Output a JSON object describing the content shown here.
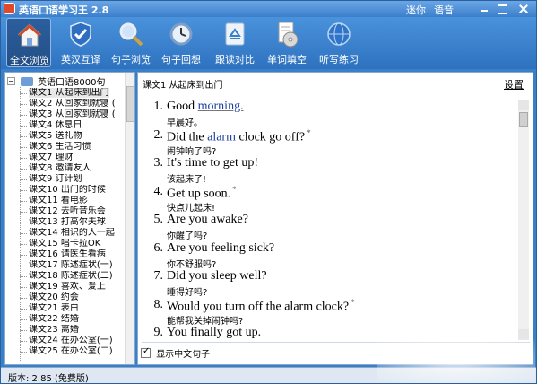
{
  "window": {
    "title": "英语口语学习王 2.8",
    "title_buttons": [
      "迷你",
      "语音"
    ]
  },
  "toolbar": {
    "items": [
      {
        "label": "全文浏览",
        "icon": "home-icon",
        "active": true
      },
      {
        "label": "英汉互译",
        "icon": "shield-check-icon",
        "active": false
      },
      {
        "label": "句子浏览",
        "icon": "magnifier-icon",
        "active": false
      },
      {
        "label": "句子回想",
        "icon": "clock-icon",
        "active": false
      },
      {
        "label": "跟读对比",
        "icon": "recycle-icon",
        "active": false
      },
      {
        "label": "单词填空",
        "icon": "document-disc-icon",
        "active": false
      },
      {
        "label": "听写练习",
        "icon": "globe-icon",
        "active": false
      }
    ]
  },
  "tree": {
    "root_label": "英语口语8000句",
    "items": [
      "课文1 从起床到出门",
      "课文2 从回家到就寝 (",
      "课文3 从回家到就寝 (",
      "课文4 休息日",
      "课文5 送礼物",
      "课文6 生活习惯",
      "课文7 理财",
      "课文8 邀请友人",
      "课文9 订计划",
      "课文10 出门的时候",
      "课文11 看电影",
      "课文12 去听音乐会",
      "课文13 打高尔夫球",
      "课文14 相识的人一起",
      "课文15 唱卡拉OK",
      "课文16 请医生看病",
      "课文17 陈述症状(一)",
      "课文18 陈述症状(二)",
      "课文19 喜欢、爱上",
      "课文20 约会",
      "课文21 表白",
      "课文22 结婚",
      "课文23 离婚",
      "课文24 在办公室(一)",
      "课文25 在办公室(二)"
    ],
    "selected_index": 0
  },
  "content": {
    "lesson_header": "课文1 从起床到出门",
    "settings_label": "设置",
    "sentences": [
      {
        "num": "1.",
        "en_parts": [
          {
            "t": "Good ",
            "hl": false
          },
          {
            "t": "morning.",
            "hl": true
          }
        ],
        "star": false,
        "zh": "早晨好。"
      },
      {
        "num": "2.",
        "en_parts": [
          {
            "t": "Did the ",
            "hl": false
          },
          {
            "t": "alarm",
            "hl": true
          },
          {
            "t": " clock go off?",
            "hl": false
          }
        ],
        "star": true,
        "zh": "闹钟响了吗?"
      },
      {
        "num": "3.",
        "en_parts": [
          {
            "t": "It's time to get up!",
            "hl": false
          }
        ],
        "star": false,
        "zh": "该起床了!"
      },
      {
        "num": "4.",
        "en_parts": [
          {
            "t": "Get up soon.",
            "hl": false
          }
        ],
        "star": true,
        "zh": "快点儿起床!"
      },
      {
        "num": "5.",
        "en_parts": [
          {
            "t": "Are you awake?",
            "hl": false
          }
        ],
        "star": false,
        "zh": "你醒了吗?"
      },
      {
        "num": "6.",
        "en_parts": [
          {
            "t": "Are you feeling sick?",
            "hl": false
          }
        ],
        "star": false,
        "zh": "你不舒服吗?"
      },
      {
        "num": "7.",
        "en_parts": [
          {
            "t": "Did you sleep well?",
            "hl": false
          }
        ],
        "star": false,
        "zh": "睡得好吗?"
      },
      {
        "num": "8.",
        "en_parts": [
          {
            "t": "Would you turn off the alarm clock?",
            "hl": false
          }
        ],
        "star": true,
        "zh": "能帮我关掉闹钟吗?"
      },
      {
        "num": "9.",
        "en_parts": [
          {
            "t": "You finally got up.",
            "hl": false
          }
        ],
        "star": false,
        "zh": ""
      }
    ],
    "star_mark": "*",
    "show_chinese_label": "显示中文句子",
    "show_chinese_checked": true
  },
  "status": {
    "text": "版本: 2.85 (免费版)"
  },
  "colors": {
    "toolbar_blue": "#3a80c8",
    "highlight_word": "#1a3fa0"
  }
}
